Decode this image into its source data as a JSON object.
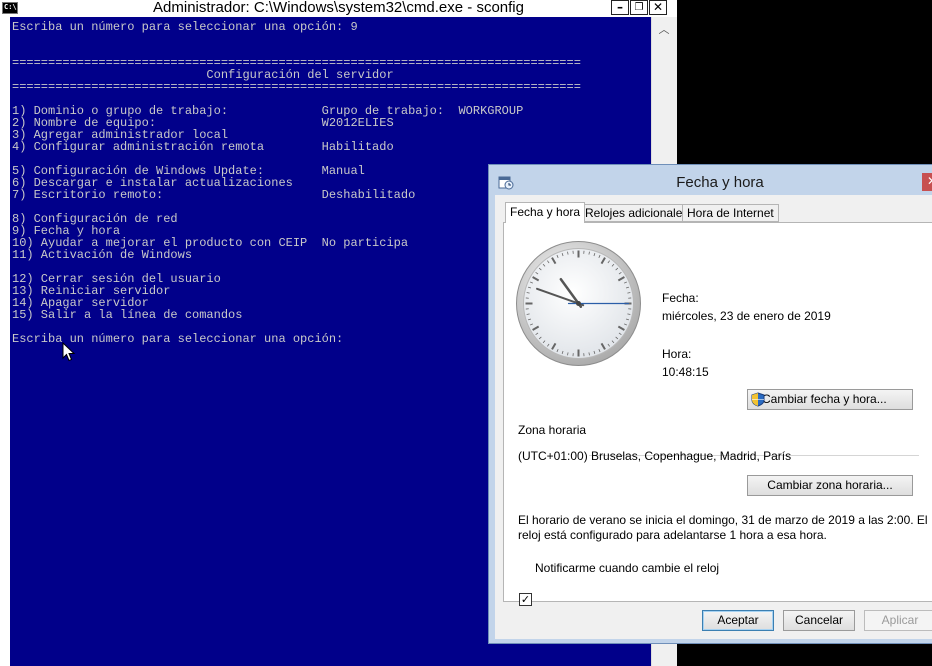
{
  "cmd_window": {
    "title": "Administrador: C:\\Windows\\system32\\cmd.exe - sconfig",
    "icon_text": "C:\\",
    "controls": {
      "minimize": "–",
      "restore": "❐",
      "close": "✕"
    },
    "console_lines": [
      "Escriba un número para seleccionar una opción: 9",
      "",
      "",
      "===============================================================================",
      "                           Configuración del servidor",
      "===============================================================================",
      "",
      "1) Dominio o grupo de trabajo:             Grupo de trabajo:  WORKGROUP",
      "2) Nombre de equipo:                       W2012ELIES",
      "3) Agregar administrador local",
      "4) Configurar administración remota        Habilitado",
      "",
      "5) Configuración de Windows Update:        Manual",
      "6) Descargar e instalar actualizaciones",
      "7) Escritorio remoto:                      Deshabilitado",
      "",
      "8) Configuración de red",
      "9) Fecha y hora",
      "10) Ayudar a mejorar el producto con CEIP  No participa",
      "11) Activación de Windows",
      "",
      "12) Cerrar sesión del usuario",
      "13) Reiniciar servidor",
      "14) Apagar servidor",
      "15) Salir a la línea de comandos",
      "",
      "Escriba un número para seleccionar una opción:"
    ]
  },
  "dialog": {
    "title": "Fecha y hora",
    "close": "✕",
    "tabs": [
      {
        "label": "Fecha y hora"
      },
      {
        "label": "Relojes adicionales"
      },
      {
        "label": "Hora de Internet"
      }
    ],
    "date_label": "Fecha:",
    "date_value": "miércoles, 23 de enero de 2019",
    "time_label": "Hora:",
    "time_value": "10:48:15",
    "clock": {
      "hours": 10,
      "minutes": 48,
      "seconds": 15
    },
    "change_datetime_button": "Cambiar fecha y hora...",
    "timezone_group": "Zona horaria",
    "timezone_value": "(UTC+01:00) Bruselas, Copenhague, Madrid, París",
    "change_timezone_button": "Cambiar zona horaria...",
    "dst_line1": "El horario de verano se inicia el domingo, 31 de marzo de 2019 a las 2:00. El",
    "dst_line2": "reloj está configurado para adelantarse 1 hora a esa hora.",
    "notify_checkbox": "Notificarme cuando cambie el reloj",
    "notify_checked": true,
    "check_mark": "✓",
    "ok_button": "Aceptar",
    "cancel_button": "Cancelar",
    "apply_button": "Aplicar"
  }
}
